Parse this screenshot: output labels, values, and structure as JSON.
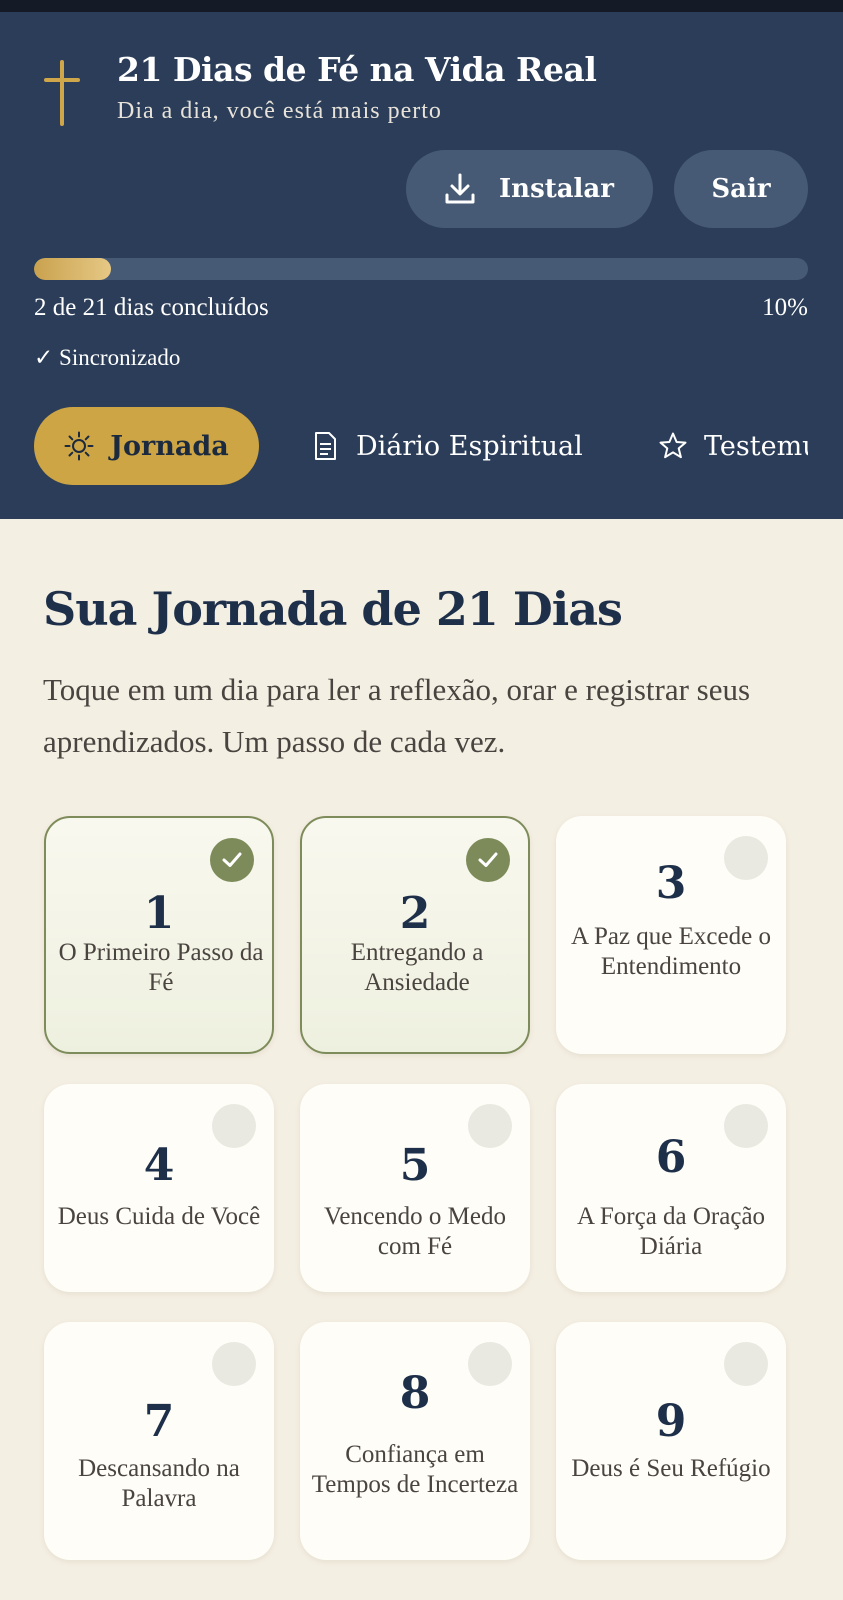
{
  "header": {
    "app_title": "21 Dias de Fé na Vida Real",
    "app_subtitle": "Dia a dia, você está mais perto",
    "install_label": "Instalar",
    "exit_label": "Sair",
    "progress_text": "2 de 21 dias concluídos",
    "progress_percent_label": "10%",
    "progress_fraction": 0.1,
    "sync_status": "✓ Sincronizado",
    "tabs": [
      {
        "label": "Jornada",
        "icon": "sun-icon",
        "active": true
      },
      {
        "label": "Diário Espiritual",
        "icon": "document-icon",
        "active": false
      },
      {
        "label": "Testemunhos",
        "icon": "star-icon",
        "active": false
      }
    ]
  },
  "main": {
    "title": "Sua Jornada de 21 Dias",
    "description": "Toque em um dia para ler a reflexão, orar e registrar seus aprendizados. Um passo de cada vez.",
    "days": [
      {
        "number": "1",
        "title": "O Primeiro Passo da Fé",
        "completed": true
      },
      {
        "number": "2",
        "title": "Entregando a Ansiedade",
        "completed": true
      },
      {
        "number": "3",
        "title": "A Paz que Excede o Entendimento",
        "completed": false
      },
      {
        "number": "4",
        "title": "Deus Cuida de Você",
        "completed": false
      },
      {
        "number": "5",
        "title": "Vencendo o Medo com Fé",
        "completed": false
      },
      {
        "number": "6",
        "title": "A Força da Oração Diária",
        "completed": false
      },
      {
        "number": "7",
        "title": "Descansando na Palavra",
        "completed": false
      },
      {
        "number": "8",
        "title": "Confiança em Tempos de Incerteza",
        "completed": false
      },
      {
        "number": "9",
        "title": "Deus é Seu Refúgio",
        "completed": false
      }
    ]
  },
  "colors": {
    "header_bg": "#2b3d58",
    "accent_gold": "#cda544",
    "completed_green": "#7c8b59",
    "page_bg": "#f4efe3",
    "title_navy": "#1e2f4a"
  }
}
